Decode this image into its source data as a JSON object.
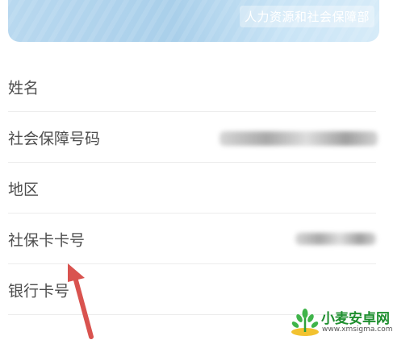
{
  "header_card": {
    "agency": "人力资源和社会保障部"
  },
  "fields": [
    {
      "label": "姓名"
    },
    {
      "label": "社会保障号码"
    },
    {
      "label": "地区"
    },
    {
      "label": "社保卡卡号"
    },
    {
      "label": "银行卡号"
    }
  ],
  "watermark": {
    "title": "小麦安卓网",
    "url": "www.xmsigma.com"
  },
  "colors": {
    "card_gradient_start": "#b8d8ef",
    "card_gradient_end": "#d6ebf8",
    "annotation_arrow": "#d9534f",
    "watermark_green": "#1f8f2f"
  },
  "icons": {
    "annotation": "arrow-up-icon",
    "watermark_logo": "wheat-logo-icon"
  }
}
